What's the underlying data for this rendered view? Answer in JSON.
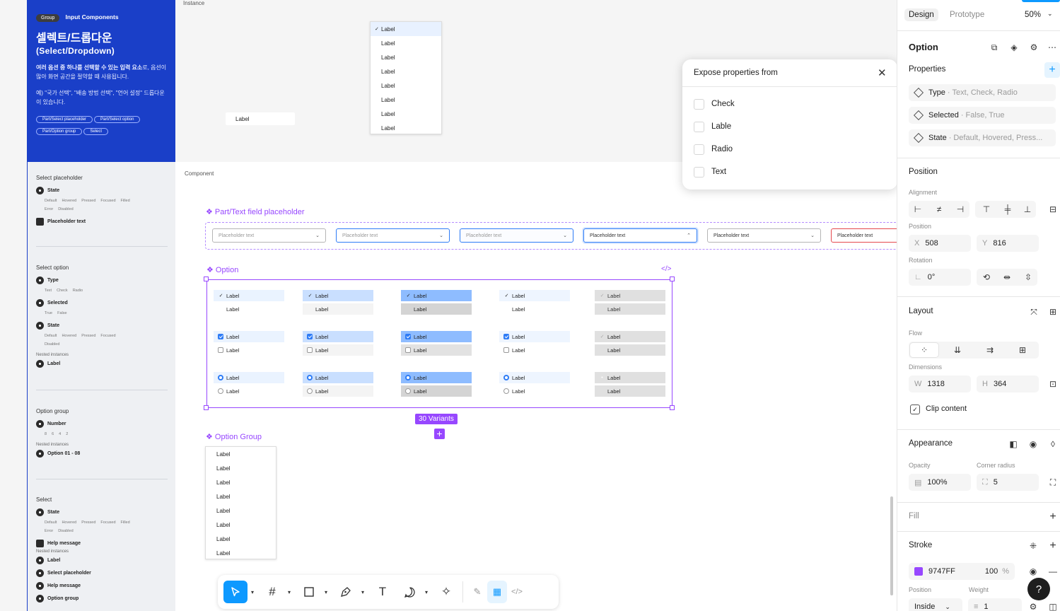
{
  "doc": {
    "group_tag": "Group",
    "group_title": "Input Components",
    "title_kr": "셀렉트/드롭다운",
    "title_en": "(Select/Dropdown)",
    "desc1_bold": "여러 옵션 중 하나를 선택할 수 있는 입력 요소",
    "desc1_rest": "로, 옵션이 많아 화면 공간을 절약할 때 사용됩니다.",
    "desc2": "예) \"국가 선택\", \"배송 방법 선택\", \"언어 설정\" 드롭다운이 있습니다.",
    "chips": [
      "Part/Select placeholder",
      "Part/Select option",
      "Part/Option group",
      "Select"
    ],
    "sections": {
      "placeholder": {
        "title": "Select placeholder",
        "state": "State",
        "state_values": [
          "Default",
          "Hovered",
          "Pressed",
          "Focused",
          "Filled",
          "Error",
          "Disabled"
        ],
        "text": "Placeholder text"
      },
      "option": {
        "title": "Select option",
        "type": "Type",
        "type_values": [
          "Text",
          "Check",
          "Radio"
        ],
        "selected": "Selected",
        "selected_values": [
          "True",
          "False"
        ],
        "state": "State",
        "state_values": [
          "Default",
          "Hovered",
          "Pressed",
          "Focused",
          "Disabled"
        ],
        "nested": "Nested instances",
        "label": "Label"
      },
      "group": {
        "title": "Option group",
        "number": "Number",
        "number_values": [
          "8",
          "6",
          "4",
          "2"
        ],
        "nested": "Nested instances",
        "item": "Option 01 - 08"
      },
      "select": {
        "title": "Select",
        "state": "State",
        "state_values": [
          "Default",
          "Hovered",
          "Pressed",
          "Focused",
          "Filled",
          "Error",
          "Disabled"
        ],
        "help": "Help message",
        "nested": "Nested instances",
        "n1": "Label",
        "n2": "Select placeholder",
        "n3": "Help message",
        "n4": "Option group"
      }
    }
  },
  "canvas": {
    "instance_label": "Instance",
    "component_label": "Component",
    "instance_input_label": "Label",
    "instance_list": [
      "Label",
      "Label",
      "Label",
      "Label",
      "Label",
      "Label",
      "Label",
      "Label"
    ],
    "textfield_title": "Part/Text field placeholder",
    "placeholder_text": "Placeholder text",
    "option_title": "Option",
    "option_label": "Label",
    "variants_badge": "30 Variants",
    "option_group_title": "Option Group",
    "group_list": [
      "Label",
      "Label",
      "Label",
      "Label",
      "Label",
      "Label",
      "Label",
      "Label"
    ]
  },
  "popup": {
    "title": "Expose properties from",
    "items": [
      "Check",
      "Lable",
      "Radio",
      "Text"
    ]
  },
  "right": {
    "tab_design": "Design",
    "tab_prototype": "Prototype",
    "zoom": "50%",
    "component_name": "Option",
    "properties_title": "Properties",
    "properties": [
      {
        "name": "Type",
        "values": "Text, Check, Radio"
      },
      {
        "name": "Selected",
        "values": "False, True"
      },
      {
        "name": "State",
        "values": "Default, Hovered, Press..."
      }
    ],
    "position_title": "Position",
    "alignment_label": "Alignment",
    "position_label": "Position",
    "x_label": "X",
    "x": "508",
    "y_label": "Y",
    "y": "816",
    "rotation_label": "Rotation",
    "rotation": "0°",
    "layout_title": "Layout",
    "flow_label": "Flow",
    "dimensions_label": "Dimensions",
    "w_label": "W",
    "w": "1318",
    "h_label": "H",
    "h": "364",
    "clip_content": "Clip content",
    "appearance_title": "Appearance",
    "opacity_label": "Opacity",
    "opacity": "100%",
    "radius_label": "Corner radius",
    "radius": "5",
    "fill_title": "Fill",
    "stroke_title": "Stroke",
    "stroke_color": "9747FF",
    "stroke_swatch": "#9747ff",
    "stroke_opacity": "100",
    "stroke_pct": "%",
    "stroke_position_label": "Position",
    "stroke_weight_label": "Weight",
    "stroke_position": "Inside",
    "stroke_weight": "1"
  },
  "colors": {
    "brand": "#1a3fc8",
    "component": "#9747ff",
    "accent": "#0d99ff"
  }
}
